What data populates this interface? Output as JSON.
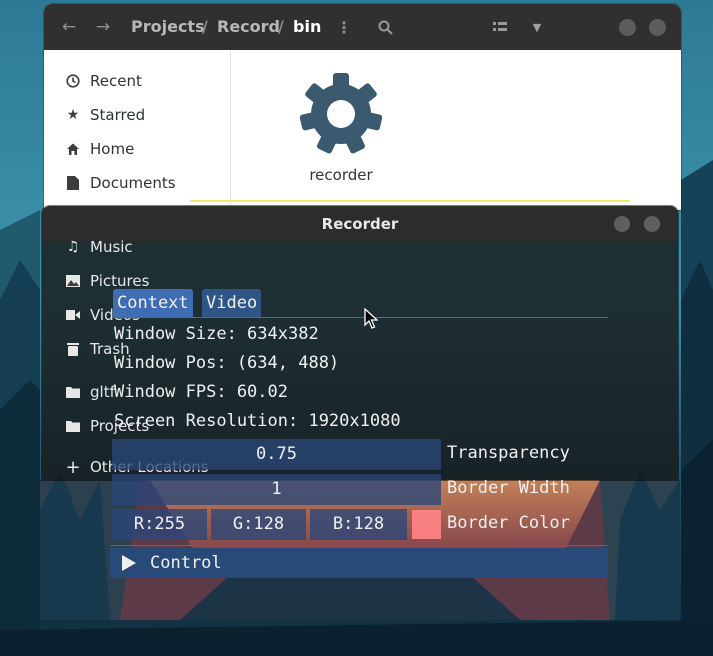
{
  "file_manager": {
    "breadcrumb": [
      "Projects",
      "Record",
      "bin"
    ],
    "sidebar": [
      {
        "label": "Recent",
        "icon": "clock-icon"
      },
      {
        "label": "Starred",
        "icon": "star-icon"
      },
      {
        "label": "Home",
        "icon": "home-icon"
      },
      {
        "label": "Documents",
        "icon": "document-icon"
      },
      {
        "label": "Music",
        "icon": "music-icon"
      },
      {
        "label": "Pictures",
        "icon": "picture-icon"
      },
      {
        "label": "Videos",
        "icon": "video-icon"
      },
      {
        "label": "Trash",
        "icon": "trash-icon"
      },
      {
        "label": "gltf",
        "icon": "folder-icon"
      },
      {
        "label": "Projects",
        "icon": "folder-icon"
      },
      {
        "label": "Other Locations",
        "icon": "plus-icon"
      }
    ],
    "files": [
      {
        "label": "recorder",
        "icon": "gear-icon"
      }
    ]
  },
  "recorder": {
    "title": "Recorder",
    "tabs": [
      "Context",
      "Video"
    ],
    "info": {
      "window_size": "Window Size: 634x382",
      "window_pos": "Window Pos: (634, 488)",
      "window_fps": "Window FPS: 60.02",
      "screen_resolution": "Screen Resolution: 1920x1080"
    },
    "transparency": {
      "value": "0.75",
      "label": "Transparency"
    },
    "border_width": {
      "value": "1",
      "label": "Border Width"
    },
    "border_color": {
      "r": "R:255",
      "g": "G:128",
      "b": "B:128",
      "label": "Border Color",
      "swatch": "#f88080"
    },
    "control": {
      "label": "Control"
    }
  }
}
